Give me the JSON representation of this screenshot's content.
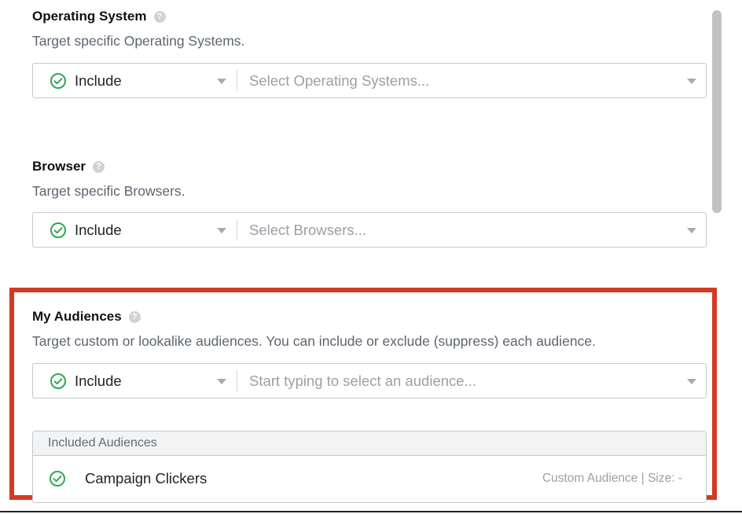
{
  "os": {
    "title": "Operating System",
    "description": "Target specific Operating Systems.",
    "mode": "Include",
    "placeholder": "Select Operating Systems..."
  },
  "browser": {
    "title": "Browser",
    "description": "Target specific Browsers.",
    "mode": "Include",
    "placeholder": "Select Browsers..."
  },
  "audiences": {
    "title": "My Audiences",
    "description": "Target custom or lookalike audiences. You can include or exclude (suppress) each audience.",
    "mode": "Include",
    "placeholder": "Start typing to select an audience...",
    "included_header": "Included Audiences",
    "items": [
      {
        "name": "Campaign Clickers",
        "meta": "Custom Audience | Size: -"
      }
    ]
  },
  "icons": {
    "help": "help-icon",
    "check": "check-circle-icon",
    "caret": "caret-down-icon"
  },
  "colors": {
    "check_green": "#2ea84f",
    "highlight_red": "#d23b22"
  }
}
